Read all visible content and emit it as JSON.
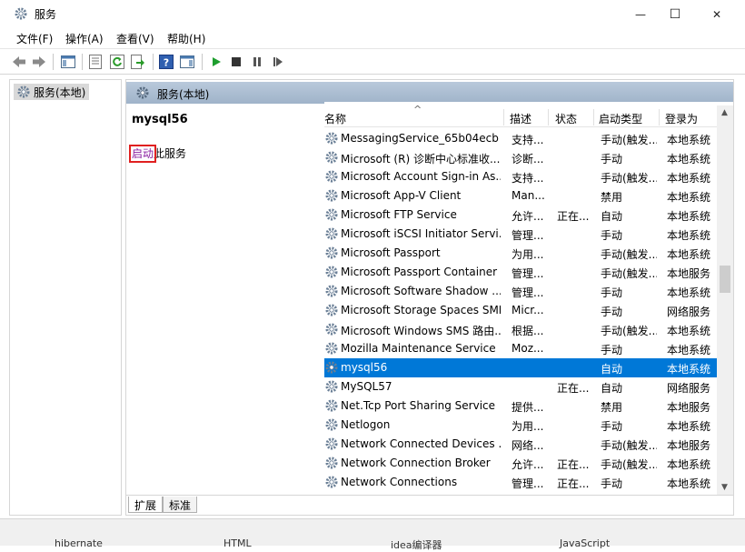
{
  "window": {
    "title": "服务",
    "minimize_glyph": "—",
    "maximize_glyph": "☐",
    "close_glyph": "✕"
  },
  "menu": [
    "文件(F)",
    "操作(A)",
    "查看(V)",
    "帮助(H)"
  ],
  "toolbar_icons": [
    "back-icon",
    "forward-icon",
    "show-hide-console-tree-icon",
    "properties-icon",
    "refresh-icon",
    "export-list-icon",
    "help-icon",
    "show-hide-action-pane-icon",
    "start-service-icon",
    "stop-service-icon",
    "pause-service-icon",
    "restart-service-icon"
  ],
  "tree": {
    "item": "服务(本地)"
  },
  "panel": {
    "header": "服务(本地)"
  },
  "extended": {
    "service_name": "mysql56",
    "start_link": "启动",
    "start_suffix": "此服务"
  },
  "table": {
    "sort_indicator": "^",
    "columns": [
      "名称",
      "描述",
      "状态",
      "启动类型",
      "登录为"
    ],
    "rows": [
      {
        "name": "MessagingService_65b04ecb",
        "desc": "支持...",
        "status": "",
        "startup": "手动(触发...",
        "logon": "本地系统"
      },
      {
        "name": "Microsoft (R) 诊断中心标准收...",
        "desc": "诊断...",
        "status": "",
        "startup": "手动",
        "logon": "本地系统"
      },
      {
        "name": "Microsoft Account Sign-in As...",
        "desc": "支持...",
        "status": "",
        "startup": "手动(触发...",
        "logon": "本地系统"
      },
      {
        "name": "Microsoft App-V Client",
        "desc": "Man...",
        "status": "",
        "startup": "禁用",
        "logon": "本地系统"
      },
      {
        "name": "Microsoft FTP Service",
        "desc": "允许...",
        "status": "正在...",
        "startup": "自动",
        "logon": "本地系统"
      },
      {
        "name": "Microsoft iSCSI Initiator Servi...",
        "desc": "管理...",
        "status": "",
        "startup": "手动",
        "logon": "本地系统"
      },
      {
        "name": "Microsoft Passport",
        "desc": "为用...",
        "status": "",
        "startup": "手动(触发...",
        "logon": "本地系统"
      },
      {
        "name": "Microsoft Passport Container",
        "desc": "管理...",
        "status": "",
        "startup": "手动(触发...",
        "logon": "本地服务"
      },
      {
        "name": "Microsoft Software Shadow ...",
        "desc": "管理...",
        "status": "",
        "startup": "手动",
        "logon": "本地系统"
      },
      {
        "name": "Microsoft Storage Spaces SMP",
        "desc": "Micr...",
        "status": "",
        "startup": "手动",
        "logon": "网络服务"
      },
      {
        "name": "Microsoft Windows SMS 路由...",
        "desc": "根据...",
        "status": "",
        "startup": "手动(触发...",
        "logon": "本地系统"
      },
      {
        "name": "Mozilla Maintenance Service",
        "desc": "Moz...",
        "status": "",
        "startup": "手动",
        "logon": "本地系统"
      },
      {
        "name": "mysql56",
        "desc": "",
        "status": "",
        "startup": "自动",
        "logon": "本地系统",
        "selected": true
      },
      {
        "name": "MySQL57",
        "desc": "",
        "status": "正在...",
        "startup": "自动",
        "logon": "网络服务"
      },
      {
        "name": "Net.Tcp Port Sharing Service",
        "desc": "提供...",
        "status": "",
        "startup": "禁用",
        "logon": "本地服务"
      },
      {
        "name": "Netlogon",
        "desc": "为用...",
        "status": "",
        "startup": "手动",
        "logon": "本地系统"
      },
      {
        "name": "Network Connected Devices ...",
        "desc": "网络...",
        "status": "",
        "startup": "手动(触发...",
        "logon": "本地服务"
      },
      {
        "name": "Network Connection Broker",
        "desc": "允许...",
        "status": "正在...",
        "startup": "手动(触发...",
        "logon": "本地系统"
      },
      {
        "name": "Network Connections",
        "desc": "管理...",
        "status": "正在...",
        "startup": "手动",
        "logon": "本地系统"
      }
    ]
  },
  "tabs": [
    "扩展",
    "标准"
  ],
  "taskbar_behind": [
    "hibernate",
    "HTML",
    "idea编译器",
    "JavaScript"
  ]
}
